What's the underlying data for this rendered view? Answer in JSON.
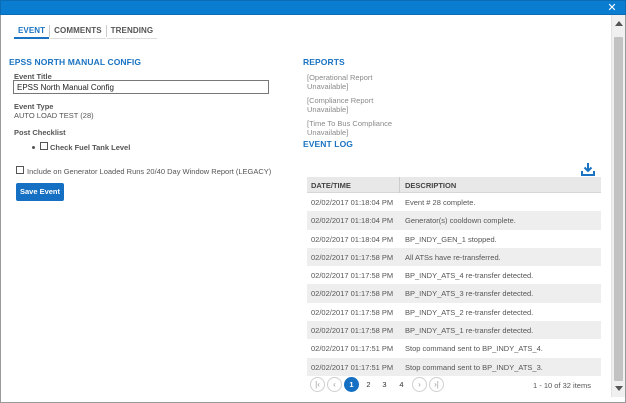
{
  "window": {
    "close_glyph": "✕"
  },
  "tabs": [
    {
      "label": "EVENT",
      "active": true
    },
    {
      "label": "COMMENTS",
      "active": false
    },
    {
      "label": "TRENDING",
      "active": false
    }
  ],
  "config": {
    "section_title": "EPSS NORTH MANUAL CONFIG",
    "event_title_label": "Event Title",
    "event_title_value": "EPSS North Manual Config",
    "event_type_label": "Event Type",
    "event_type_value": "AUTO LOAD TEST (28)",
    "post_checklist_label": "Post Checklist",
    "checklist_item": "Check Fuel Tank Level",
    "legacy_checkbox_label": "Include on Generator Loaded Runs 20/40 Day Window Report (LEGACY)",
    "save_button": "Save Event"
  },
  "reports": {
    "section_title": "REPORTS",
    "links": [
      {
        "line1": "[Operational Report",
        "line2": "Unavailable]"
      },
      {
        "line1": "[Compliance Report",
        "line2": "Unavailable]"
      },
      {
        "line1": "[Time To Bus Compliance",
        "line2": "Unavailable]"
      }
    ]
  },
  "event_log": {
    "section_title": "EVENT LOG",
    "columns": [
      "DATE/TIME",
      "DESCRIPTION"
    ],
    "rows": [
      [
        "02/02/2017 01:18:04 PM",
        "Event # 28 complete."
      ],
      [
        "02/02/2017 01:18:04 PM",
        "Generator(s) cooldown complete."
      ],
      [
        "02/02/2017 01:18:04 PM",
        "BP_INDY_GEN_1 stopped."
      ],
      [
        "02/02/2017 01:17:58 PM",
        "All ATSs have re-transferred."
      ],
      [
        "02/02/2017 01:17:58 PM",
        "BP_INDY_ATS_4 re-transfer detected."
      ],
      [
        "02/02/2017 01:17:58 PM",
        "BP_INDY_ATS_3 re-transfer detected."
      ],
      [
        "02/02/2017 01:17:58 PM",
        "BP_INDY_ATS_2 re-transfer detected."
      ],
      [
        "02/02/2017 01:17:58 PM",
        "BP_INDY_ATS_1 re-transfer detected."
      ],
      [
        "02/02/2017 01:17:51 PM",
        "Stop command sent to BP_INDY_ATS_4."
      ],
      [
        "02/02/2017 01:17:51 PM",
        "Stop command sent to BP_INDY_ATS_3."
      ]
    ],
    "pager": {
      "first": "|‹",
      "prev": "‹",
      "pages": [
        "1",
        "2",
        "3",
        "4"
      ],
      "current_page": "1",
      "next": "›",
      "last": "›|",
      "info": "1 - 10 of 32 items"
    }
  },
  "colors": {
    "accent": "#1a73c2",
    "titlebar": "#0b7dd0",
    "button": "#1570c3"
  },
  "icons": {
    "close": "close-icon",
    "download": "download-icon",
    "scroll_up": "scroll-up-icon",
    "scroll_down": "scroll-down-icon"
  }
}
